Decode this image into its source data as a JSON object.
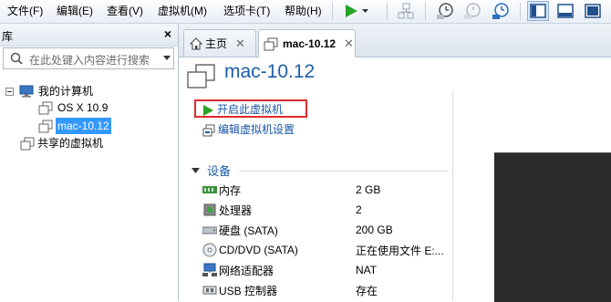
{
  "menubar": {
    "items": [
      "文件(F)",
      "编辑(E)",
      "查看(V)",
      "虚拟机(M)",
      "选项卡(T)",
      "帮助(H)"
    ]
  },
  "library": {
    "title": "库",
    "search_placeholder": "在此处键入内容进行搜索",
    "tree": {
      "root": "我的计算机",
      "children": [
        "OS X 10.9",
        "mac-10.12"
      ],
      "shared": "共享的虚拟机"
    }
  },
  "tabs": [
    {
      "label": "主页",
      "icon": "home-icon"
    },
    {
      "label": "mac-10.12",
      "icon": "vm-icon",
      "active": true
    }
  ],
  "vm": {
    "name": "mac-10.12",
    "actions": {
      "power_on": "开启此虚拟机",
      "edit_settings": "编辑虚拟机设置"
    },
    "devices_header": "设备",
    "devices": [
      {
        "name": "内存",
        "value": "2 GB",
        "icon": "memory-icon"
      },
      {
        "name": "处理器",
        "value": "2",
        "icon": "cpu-icon"
      },
      {
        "name": "硬盘 (SATA)",
        "value": "200 GB",
        "icon": "hdd-icon"
      },
      {
        "name": "CD/DVD (SATA)",
        "value": "正在使用文件 E:...",
        "icon": "cdrom-icon"
      },
      {
        "name": "网络适配器",
        "value": "NAT",
        "icon": "network-icon"
      },
      {
        "name": "USB 控制器",
        "value": "存在",
        "icon": "usb-icon"
      }
    ]
  },
  "colors": {
    "accent": "#1f5ea8",
    "play_green": "#27a327",
    "highlight_red": "#e0292b",
    "selection": "#3399ff"
  }
}
